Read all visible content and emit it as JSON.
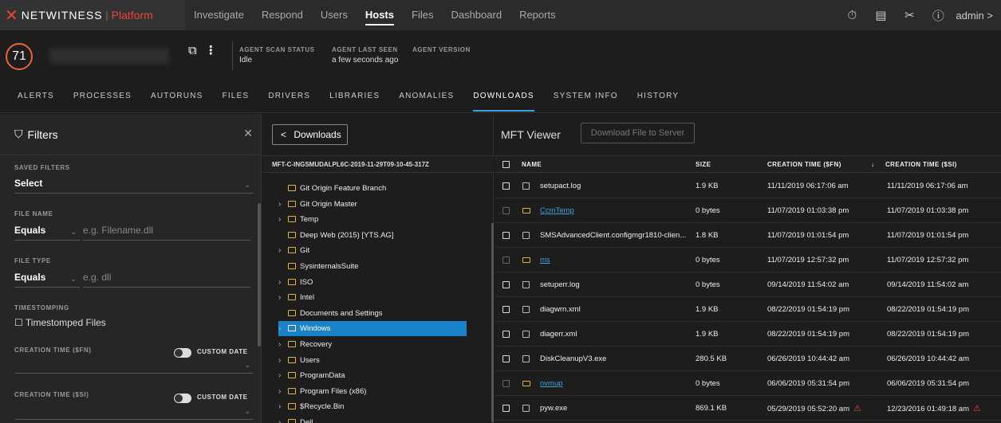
{
  "nav": {
    "brand": "NETWITNESS",
    "brand_sep": "|",
    "brand_platform": "Platform",
    "links": [
      "Investigate",
      "Respond",
      "Users",
      "Hosts",
      "Files",
      "Dashboard",
      "Reports"
    ],
    "active": "Hosts",
    "icons": [
      "timer-icon",
      "notes-icon",
      "tools-icon",
      "help-icon"
    ],
    "user": "admin >"
  },
  "host": {
    "risk_score": "71",
    "agent_scan_status_label": "AGENT SCAN STATUS",
    "agent_scan_status": "Idle",
    "agent_last_seen_label": "AGENT LAST SEEN",
    "agent_last_seen": "a few seconds ago",
    "agent_version_label": "AGENT VERSION",
    "agent_version": ""
  },
  "tabs": [
    "ALERTS",
    "PROCESSES",
    "AUTORUNS",
    "FILES",
    "DRIVERS",
    "LIBRARIES",
    "ANOMALIES",
    "DOWNLOADS",
    "SYSTEM INFO",
    "HISTORY"
  ],
  "active_tab": "DOWNLOADS",
  "filters": {
    "title": "Filters",
    "saved_filters_label": "SAVED FILTERS",
    "saved_filters_value": "Select",
    "file_name_label": "FILE NAME",
    "file_name_op": "Equals",
    "file_name_placeholder": "e.g. Filename.dll",
    "file_type_label": "FILE TYPE",
    "file_type_op": "Equals",
    "file_type_placeholder": "e.g. dll",
    "timestomping_label": "TIMESTOMPING",
    "timestomped_files": "Timestomped Files",
    "creation_fn_label": "CREATION TIME ($FN)",
    "creation_si_label": "CREATION TIME ($SI)",
    "custom_date": "CUSTOM DATE"
  },
  "tree": {
    "back_label": "Downloads",
    "path": "MFT-C-INGSMUDALPL6C-2019-11-29T09-10-45-317Z",
    "nodes": [
      {
        "label": "Git Origin Feature Branch",
        "expandable": false,
        "selected": false
      },
      {
        "label": "Git Origin Master",
        "expandable": true,
        "selected": false
      },
      {
        "label": "Temp",
        "expandable": true,
        "selected": false
      },
      {
        "label": "Deep Web (2015) [YTS.AG]",
        "expandable": false,
        "selected": false
      },
      {
        "label": "Git",
        "expandable": true,
        "selected": false
      },
      {
        "label": "SysinternalsSuite",
        "expandable": false,
        "selected": false
      },
      {
        "label": "ISO",
        "expandable": true,
        "selected": false
      },
      {
        "label": "Intel",
        "expandable": true,
        "selected": false
      },
      {
        "label": "Documents and Settings",
        "expandable": false,
        "selected": false
      },
      {
        "label": "Windows",
        "expandable": true,
        "selected": true
      },
      {
        "label": "Recovery",
        "expandable": true,
        "selected": false
      },
      {
        "label": "Users",
        "expandable": true,
        "selected": false
      },
      {
        "label": "ProgramData",
        "expandable": true,
        "selected": false
      },
      {
        "label": "Program Files (x86)",
        "expandable": true,
        "selected": false
      },
      {
        "label": "$Recycle.Bin",
        "expandable": true,
        "selected": false
      },
      {
        "label": "Dell",
        "expandable": true,
        "selected": false
      }
    ]
  },
  "mft": {
    "title": "MFT Viewer",
    "download_label": "Download File to Server",
    "columns": {
      "name": "NAME",
      "size": "SIZE",
      "creation_fn": "CREATION TIME ($FN)",
      "sort": "↓",
      "creation_si": "CREATION TIME ($SI)"
    },
    "rows": [
      {
        "name": "setupact.log",
        "folder": false,
        "size": "1.9 KB",
        "fn": "11/11/2019 06:17:06 am",
        "si": "11/11/2019 06:17:06 am",
        "fn_warn": false,
        "si_warn": false
      },
      {
        "name": "CcmTemp",
        "folder": true,
        "size": "0 bytes",
        "fn": "11/07/2019 01:03:38 pm",
        "si": "11/07/2019 01:03:38 pm",
        "fn_warn": false,
        "si_warn": false
      },
      {
        "name": "SMSAdvancedClient.configmgr1810-clien...",
        "folder": false,
        "size": "1.8 KB",
        "fn": "11/07/2019 01:01:54 pm",
        "si": "11/07/2019 01:01:54 pm",
        "fn_warn": false,
        "si_warn": false
      },
      {
        "name": "ms",
        "folder": true,
        "size": "0 bytes",
        "fn": "11/07/2019 12:57:32 pm",
        "si": "11/07/2019 12:57:32 pm",
        "fn_warn": false,
        "si_warn": false
      },
      {
        "name": "setuperr.log",
        "folder": false,
        "size": "0 bytes",
        "fn": "09/14/2019 11:54:02 am",
        "si": "09/14/2019 11:54:02 am",
        "fn_warn": false,
        "si_warn": false
      },
      {
        "name": "diagwrn.xml",
        "folder": false,
        "size": "1.9 KB",
        "fn": "08/22/2019 01:54:19 pm",
        "si": "08/22/2019 01:54:19 pm",
        "fn_warn": false,
        "si_warn": false
      },
      {
        "name": "diagerr.xml",
        "folder": false,
        "size": "1.9 KB",
        "fn": "08/22/2019 01:54:19 pm",
        "si": "08/22/2019 01:54:19 pm",
        "fn_warn": false,
        "si_warn": false
      },
      {
        "name": "DiskCleanupV3.exe",
        "folder": false,
        "size": "280.5 KB",
        "fn": "06/26/2019 10:44:42 am",
        "si": "06/26/2019 10:44:42 am",
        "fn_warn": false,
        "si_warn": false
      },
      {
        "name": "nvmup",
        "folder": true,
        "size": "0 bytes",
        "fn": "06/06/2019 05:31:54 pm",
        "si": "06/06/2019 05:31:54 pm",
        "fn_warn": false,
        "si_warn": false
      },
      {
        "name": "pyw.exe",
        "folder": false,
        "size": "869.1 KB",
        "fn": "05/29/2019 05:52:20 am",
        "si": "12/23/2016 01:49:18 am",
        "fn_warn": true,
        "si_warn": true
      }
    ]
  },
  "colors": {
    "accent": "#3fa0e0",
    "brand": "#e8443a",
    "selected": "#1a82c8",
    "folder": "#e3b33f"
  }
}
